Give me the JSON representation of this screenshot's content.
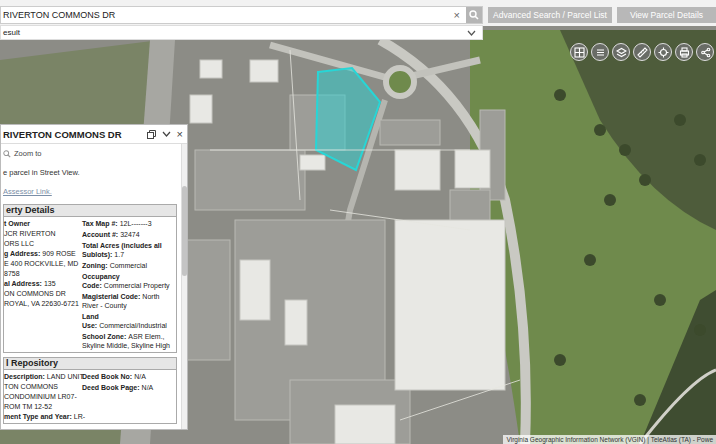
{
  "search": {
    "value": "RIVERTON COMMONS DR",
    "clear": "×"
  },
  "buttons": [
    {
      "label": "Advanced Search / Parcel List"
    },
    {
      "label": "View Parcel Details"
    }
  ],
  "result_bar": {
    "label": "esult",
    "expanded": false
  },
  "popup": {
    "title": "RIVERTON COMMONS DR",
    "close": "×",
    "zoom": "Zoom to",
    "street_view": "e parcel in Street View.",
    "assessor_link": "Assessor Link.",
    "sections": [
      {
        "title": "erty Details",
        "left": [
          {
            "label": "t Owner",
            "text": ""
          },
          {
            "label": "",
            "text": "JCR RIVERTON"
          },
          {
            "label": "",
            "text": "ORS LLC"
          },
          {
            "label": "g Address:",
            "text": "909 ROSE"
          },
          {
            "label": "",
            "text": "E 400 ROCKVILLE, MD"
          },
          {
            "label": "",
            "text": "8758"
          },
          {
            "label": "al Address:",
            "text": "135"
          },
          {
            "label": "",
            "text": "ON COMMONS DR"
          },
          {
            "label": "",
            "text": "ROYAL, VA 22630-6721"
          }
        ],
        "right": [
          {
            "label": "Tax Map #:",
            "value": "12L-------3"
          },
          {
            "label": "Account #:",
            "value": "32474"
          },
          {
            "label": "Total Acres (includes all Sublots):",
            "value": "1.7"
          },
          {
            "label": "Zoning:",
            "value": "Commercial"
          },
          {
            "label": "Occupancy Code:",
            "value": "Commercial Property"
          },
          {
            "label": "Magisterial Code:",
            "value": "North River - County"
          },
          {
            "label": "Land Use:",
            "value": "Commercial/Industrial"
          },
          {
            "label": "School Zone:",
            "value": "ASR Elem., Skyline Middle, Skyline High"
          }
        ]
      },
      {
        "title": "l Repository",
        "left": [
          {
            "label": "Description:",
            "text": "LAND UNIT"
          },
          {
            "label": "",
            "text": "TON COMMONS"
          },
          {
            "label": "",
            "text": "CONDOMINIUM LR07-"
          },
          {
            "label": "",
            "text": "ROM TM 12-52"
          },
          {
            "label": "ment Type and Year:",
            "text": "LR-"
          }
        ],
        "right": [
          {
            "label": "Deed Book No:",
            "value": "N/A"
          },
          {
            "label": "Deed Book Page:",
            "value": "N/A"
          }
        ]
      }
    ]
  },
  "attribution": "Virginia Geographic Information Network (VGIN) | TeleAtlas (TA) - Powe"
}
